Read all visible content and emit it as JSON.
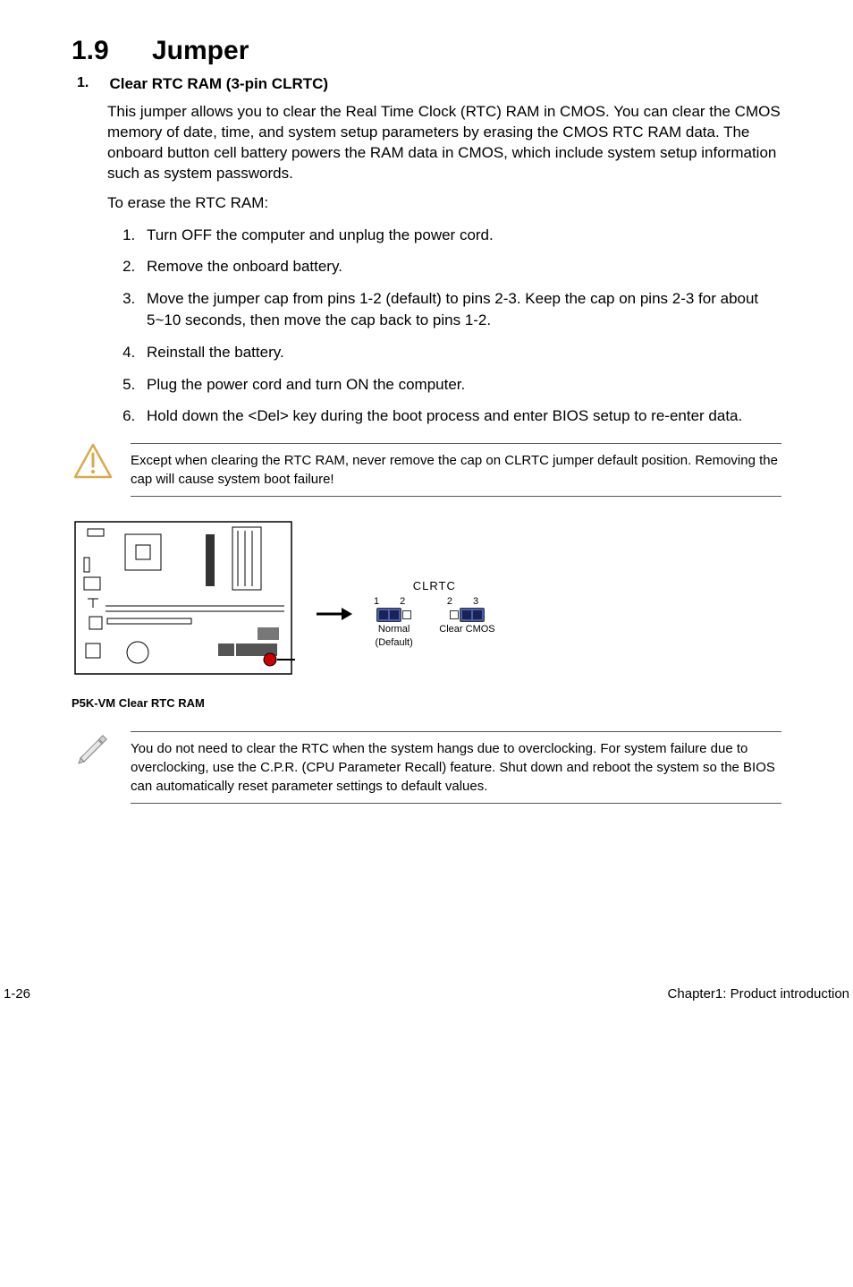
{
  "heading": {
    "number": "1.9",
    "title": "Jumper"
  },
  "item1": {
    "number": "1.",
    "title": "Clear RTC RAM (3-pin CLRTC)",
    "para1": "This jumper allows you to clear the  Real Time Clock (RTC) RAM in CMOS. You can clear the CMOS memory of date, time, and system setup parameters by erasing the CMOS RTC RAM data. The onboard button cell battery powers the RAM data in CMOS, which include system setup information such as system passwords.",
    "para2": "To erase the RTC RAM:",
    "steps": [
      "Turn OFF the computer and unplug the power cord.",
      "Remove the onboard battery.",
      "Move the jumper cap from pins 1-2 (default) to pins 2-3. Keep the cap on pins 2-3 for about 5~10 seconds, then move the cap back to pins 1-2.",
      "Reinstall the battery.",
      "Plug the power cord and turn ON the computer.",
      "Hold down the <Del> key during the boot process and enter BIOS setup to re-enter data."
    ],
    "warning": "Except when clearing the RTC RAM, never remove the cap on CLRTC jumper default position. Removing the cap will cause system boot failure!",
    "diagram": {
      "board_caption": "P5K-VM Clear RTC RAM",
      "header_label": "CLRTC",
      "normal": {
        "pins": "1  2",
        "caption1": "Normal",
        "caption2": "(Default)"
      },
      "clear": {
        "pins": "2  3",
        "caption1": "Clear CMOS"
      }
    },
    "note": "You do not need to clear the RTC when the system hangs due to overclocking. For system failure due to overclocking, use the C.P.R. (CPU Parameter Recall) feature. Shut down and reboot the system so the BIOS can automatically reset parameter settings to default values."
  },
  "footer": {
    "left": "1-26",
    "right": "Chapter1: Product introduction"
  }
}
